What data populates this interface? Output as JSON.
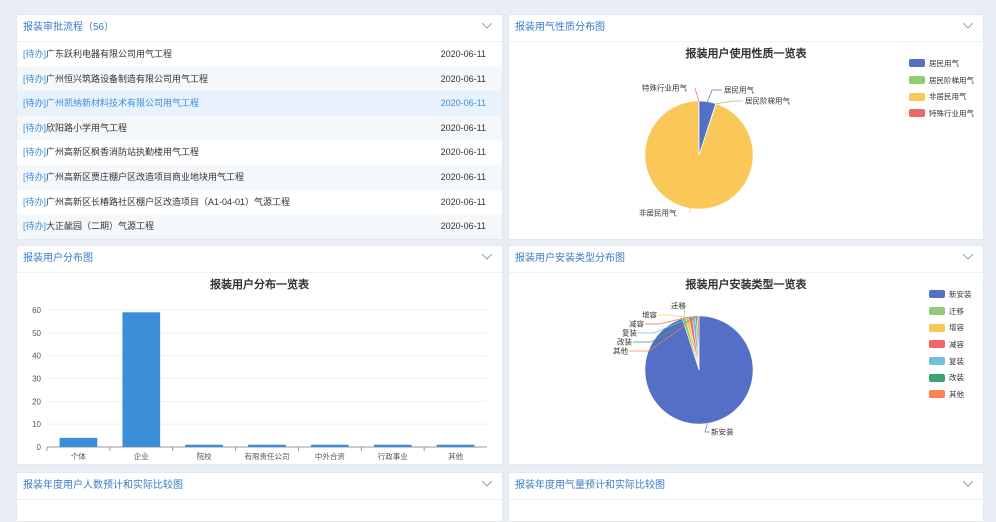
{
  "approval": {
    "title": "报装审批流程（56）",
    "items": [
      {
        "tag": "[待办]",
        "name": "广东跃利电器有限公司用气工程",
        "date": "2020-06-11"
      },
      {
        "tag": "[待办]",
        "name": "广州恒兴筑路设备制造有限公司用气工程",
        "date": "2020-06-11"
      },
      {
        "tag": "[待办]",
        "name": "广州凯纳新材料技术有限公司用气工程",
        "date": "2020-06-11"
      },
      {
        "tag": "[待办]",
        "name": "欣阳路小学用气工程",
        "date": "2020-06-11"
      },
      {
        "tag": "[待办]",
        "name": "广州高新区枫香消防站执勤楼用气工程",
        "date": "2020-06-11"
      },
      {
        "tag": "[待办]",
        "name": "广州高新区贾庄棚户区改造项目商业地块用气工程",
        "date": "2020-06-11"
      },
      {
        "tag": "[待办]",
        "name": "广州高新区长椿路社区棚户区改造项目（A1-04-01）气源工程",
        "date": "2020-06-11"
      },
      {
        "tag": "[待办]",
        "name": "大正龇园（二期）气源工程",
        "date": "2020-06-11"
      }
    ]
  },
  "gas_nature": {
    "panel_title": "报装用气性质分布图",
    "chart_data": {
      "type": "pie",
      "title": "报装用户使用性质一览表",
      "labels": [
        "居民用气",
        "居民阶梯用气",
        "非居民用气",
        "特殊行业用气"
      ],
      "values": [
        5,
        0.2,
        94.6,
        0.2
      ],
      "colors": [
        "#5470c6",
        "#91cc75",
        "#fac858",
        "#ee6666"
      ],
      "legend_position": "top-right"
    }
  },
  "user_dist": {
    "panel_title": "报装用户分布图",
    "chart_data": {
      "type": "bar",
      "title": "报装用户分布一览表",
      "categories": [
        "个体",
        "企业",
        "院校",
        "有限责任公司",
        "中外合资",
        "行政事业",
        "其他"
      ],
      "values": [
        4,
        59,
        1,
        1,
        1,
        1,
        1
      ],
      "ylim": [
        0,
        60
      ],
      "yticks": [
        0,
        10,
        20,
        30,
        40,
        50,
        60
      ],
      "color": "#3a8fd8",
      "grid": true
    }
  },
  "install_type": {
    "panel_title": "报装用户安装类型分布图",
    "chart_data": {
      "type": "pie",
      "title": "报装用户安装类型一览表",
      "labels": [
        "新安装",
        "迁移",
        "增容",
        "减容",
        "复装",
        "改装",
        "其他"
      ],
      "values": [
        95,
        1,
        1,
        1,
        1,
        0.5,
        0.5
      ],
      "colors": [
        "#5470c6",
        "#91cc75",
        "#fac858",
        "#ee6666",
        "#73c0de",
        "#3ba272",
        "#fc8452"
      ],
      "legend_position": "top-right"
    }
  },
  "annual_users": {
    "panel_title": "报装年度用户人数预计和实际比较图"
  },
  "annual_gas": {
    "panel_title": "报装年度用气量预计和实际比较图"
  }
}
